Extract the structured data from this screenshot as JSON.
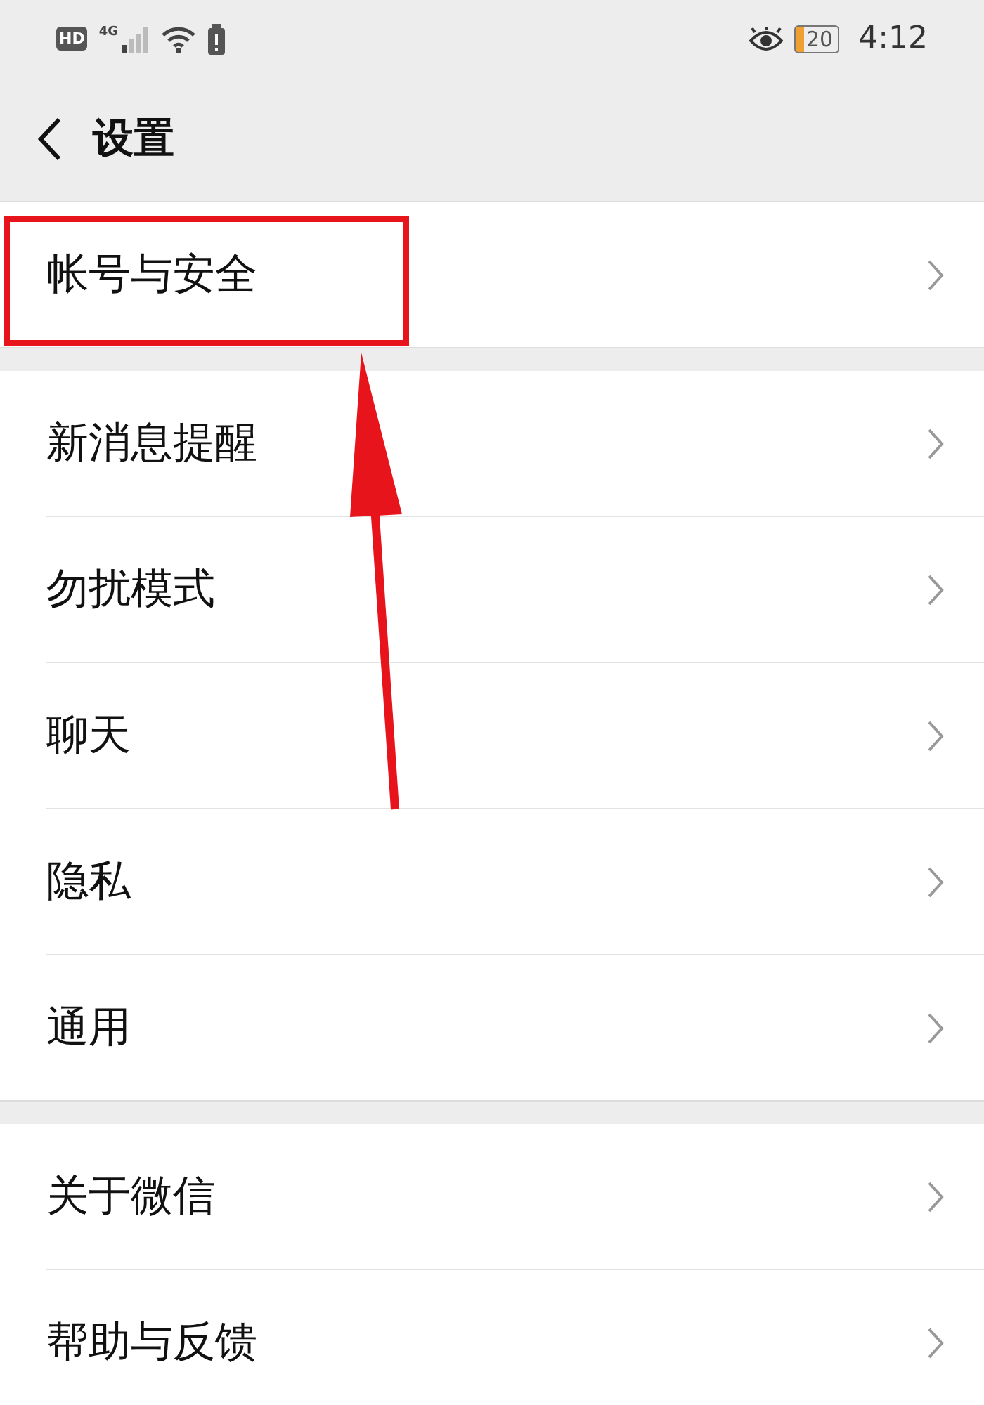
{
  "status_bar": {
    "hd": "HD",
    "network": "4G",
    "battery": "20",
    "time": "4:12"
  },
  "header": {
    "title": "设置"
  },
  "groups": [
    [
      {
        "label": "帐号与安全",
        "highlighted": true
      }
    ],
    [
      {
        "label": "新消息提醒",
        "highlighted": false
      },
      {
        "label": "勿扰模式",
        "highlighted": false
      },
      {
        "label": "聊天",
        "highlighted": false
      },
      {
        "label": "隐私",
        "highlighted": false
      },
      {
        "label": "通用",
        "highlighted": false
      }
    ],
    [
      {
        "label": "关于微信",
        "highlighted": false
      },
      {
        "label": "帮助与反馈",
        "highlighted": false
      }
    ]
  ]
}
